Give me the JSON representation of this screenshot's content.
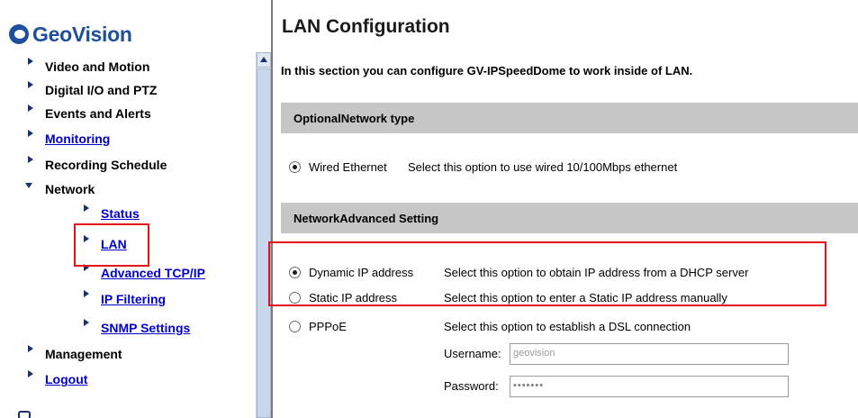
{
  "brand": {
    "name": "GeoVision",
    "color": "#1d4f9c"
  },
  "nav": {
    "items": [
      {
        "label": "Video and Motion",
        "link": false,
        "indent": 0
      },
      {
        "label": "Digital I/O and PTZ",
        "link": false,
        "indent": 0
      },
      {
        "label": "Events and Alerts",
        "link": false,
        "indent": 0
      },
      {
        "label": "Monitoring",
        "link": true,
        "indent": 0
      },
      {
        "label": "Recording Schedule",
        "link": false,
        "indent": 0
      },
      {
        "label": "Network",
        "link": false,
        "indent": 0,
        "expanded": true
      },
      {
        "label": "Status",
        "link": true,
        "indent": 1
      },
      {
        "label": "LAN",
        "link": true,
        "indent": 1,
        "highlighted": true
      },
      {
        "label": "Advanced TCP/IP",
        "link": true,
        "indent": 1
      },
      {
        "label": "IP Filtering",
        "link": true,
        "indent": 1
      },
      {
        "label": "SNMP Settings",
        "link": true,
        "indent": 1
      },
      {
        "label": "Management",
        "link": false,
        "indent": 0
      },
      {
        "label": "Logout",
        "link": true,
        "indent": 0
      }
    ]
  },
  "main": {
    "title": "LAN Configuration",
    "intro": "In this section you can configure GV-IPSpeedDome to work inside of LAN.",
    "section_network_type": "OptionalNetwork type",
    "wired": {
      "label": "Wired Ethernet",
      "desc": "Select this option to use wired 10/100Mbps ethernet",
      "selected": true
    },
    "section_advanced": "NetworkAdvanced Setting",
    "options": [
      {
        "label": "Dynamic IP address",
        "desc": "Select this option to obtain IP address from a DHCP server",
        "selected": true
      },
      {
        "label": "Static IP address",
        "desc": "Select this option to enter a Static IP address manually",
        "selected": false
      },
      {
        "label": "PPPoE",
        "desc": "Select this option to establish a DSL connection",
        "selected": false
      }
    ],
    "username_label": "Username:",
    "username_value": "geovision",
    "password_label": "Password:",
    "password_value": "•••••••"
  },
  "colors": {
    "highlight_box": "#e3101a",
    "section_bg": "#c6c6c6",
    "link": "#0000cc"
  }
}
